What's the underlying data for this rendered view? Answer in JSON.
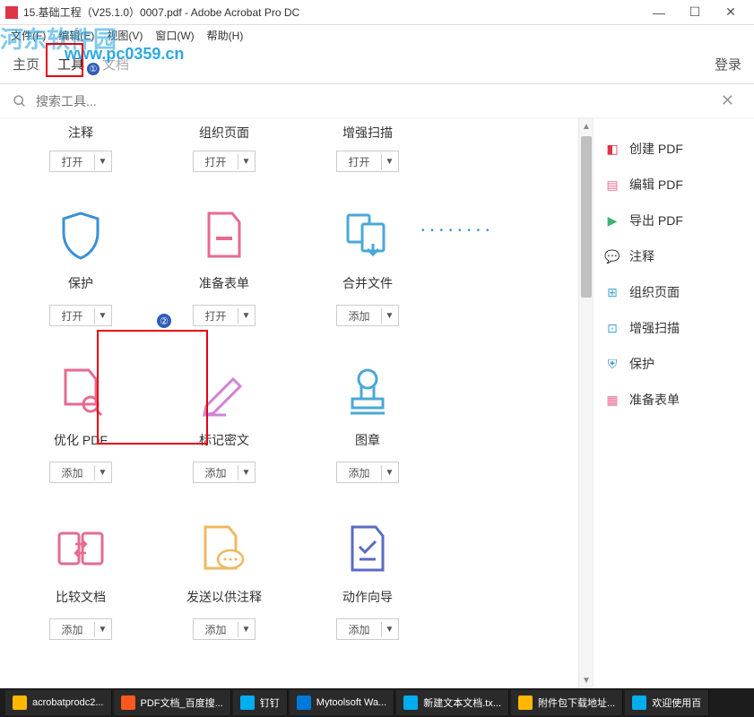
{
  "window": {
    "title": "15.基础工程（V25.1.0）0007.pdf - Adobe Acrobat Pro DC",
    "min": "—",
    "max": "☐",
    "close": "✕"
  },
  "menu": [
    "文件(F)",
    "编辑(E)",
    "视图(V)",
    "窗口(W)",
    "帮助(H)"
  ],
  "topnav": {
    "home": "主页",
    "tools": "工具",
    "doc": "文档",
    "login": "登录"
  },
  "watermark": "www.pc0359.cn",
  "watermark2": "河东软件园",
  "search": {
    "placeholder": "搜索工具..."
  },
  "annotations": {
    "marker1": "①",
    "marker2": "②"
  },
  "tools_partial": [
    {
      "label": "注释",
      "btn": "打开"
    },
    {
      "label": "组织页面",
      "btn": "打开"
    },
    {
      "label": "增强扫描",
      "btn": "打开"
    }
  ],
  "tools_row1": [
    {
      "label": "保护",
      "btn": "打开",
      "iconColor": "#3b8fd6",
      "iconType": "shield"
    },
    {
      "label": "准备表单",
      "btn": "打开",
      "iconColor": "#e66b8f",
      "iconType": "form"
    },
    {
      "label": "合并文件",
      "btn": "添加",
      "iconColor": "#4aa8d8",
      "iconType": "combine"
    }
  ],
  "tools_row2": [
    {
      "label": "优化 PDF",
      "btn": "添加",
      "iconColor": "#e66b8f",
      "iconType": "optimize"
    },
    {
      "label": "标记密文",
      "btn": "添加",
      "iconColor": "#d083d6",
      "iconType": "redact"
    },
    {
      "label": "图章",
      "btn": "添加",
      "iconColor": "#4aa8d8",
      "iconType": "stamp"
    }
  ],
  "tools_row3": [
    {
      "label": "比较文档",
      "btn": "添加",
      "iconColor": "#e66b8f",
      "iconType": "compare"
    },
    {
      "label": "发送以供注释",
      "btn": "添加",
      "iconColor": "#f0b860",
      "iconType": "send"
    },
    {
      "label": "动作向导",
      "btn": "添加",
      "iconColor": "#5a6bc4",
      "iconType": "action"
    }
  ],
  "sidebar": [
    {
      "label": "创建 PDF",
      "color": "#dc3545"
    },
    {
      "label": "编辑 PDF",
      "color": "#e66b8f"
    },
    {
      "label": "导出 PDF",
      "color": "#3cb371"
    },
    {
      "label": "注释",
      "color": "#f0b860"
    },
    {
      "label": "组织页面",
      "color": "#4aa8d8"
    },
    {
      "label": "增强扫描",
      "color": "#4aa8d8"
    },
    {
      "label": "保护",
      "color": "#3b8fd6"
    },
    {
      "label": "准备表单",
      "color": "#e66b8f"
    }
  ],
  "taskbar": [
    {
      "label": "acrobatprodc2...",
      "color": "#ffb700"
    },
    {
      "label": "PDF文档_百度搜...",
      "color": "#ff5722"
    },
    {
      "label": "钉钉",
      "color": "#00aeef"
    },
    {
      "label": "Mytoolsoft Wa...",
      "color": "#0078d7"
    },
    {
      "label": "新建文本文档.tx...",
      "color": "#00aeef"
    },
    {
      "label": "附件包下载地址...",
      "color": "#ffb700"
    },
    {
      "label": "欢迎使用百",
      "color": "#00aeef"
    }
  ]
}
